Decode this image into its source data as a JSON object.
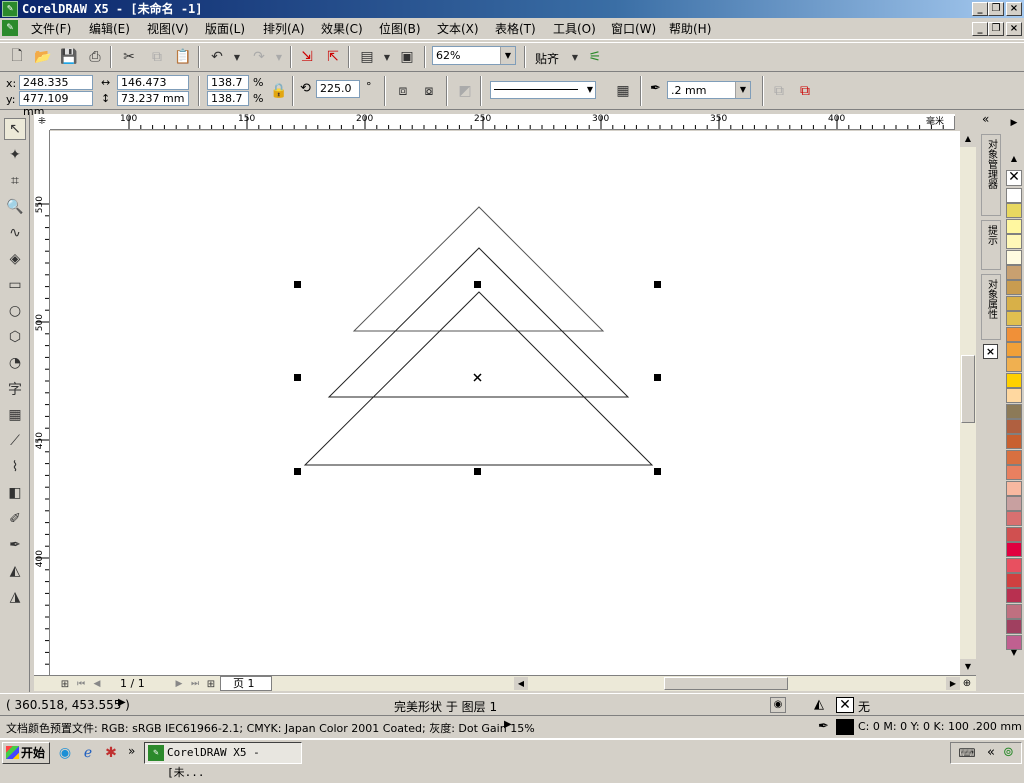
{
  "window": {
    "title": "CorelDRAW X5 - [未命名 -1]",
    "app_icon": "corel-icon"
  },
  "menu": [
    "文件(F)",
    "编辑(E)",
    "视图(V)",
    "版面(L)",
    "排列(A)",
    "效果(C)",
    "位图(B)",
    "文本(X)",
    "表格(T)",
    "工具(O)",
    "窗口(W)",
    "帮助(H)"
  ],
  "toolbar": {
    "zoom": "62%",
    "snap_label": "贴齐"
  },
  "props": {
    "x_label": "x:",
    "y_label": "y:",
    "x": "248.335 mm",
    "y": "477.109 mm",
    "w": "146.473 mm",
    "h": "73.237 mm",
    "sx": "138.7",
    "sy": "138.7",
    "pct": "%",
    "rotation": "225.0",
    "deg": "°",
    "outline_width": ".2 mm"
  },
  "rulers": {
    "top_ticks": [
      "100",
      "150",
      "200",
      "250",
      "300",
      "350",
      "400"
    ],
    "left_ticks": [
      "550",
      "500",
      "450",
      "400"
    ],
    "unit": "毫米"
  },
  "page_nav": {
    "pages": "1 / 1",
    "tab": "页 1"
  },
  "dockers": {
    "tab1": "对象管理器",
    "tab2": "提示",
    "tab3": "对象属性"
  },
  "palette": [
    "#ffffff",
    "#e8d860",
    "#fff7a0",
    "#fff8b8",
    "#fffbe0",
    "#c8a070",
    "#c89c50",
    "#d8b048",
    "#e0c050",
    "#f09038",
    "#f0a038",
    "#f0b050",
    "#ffd000",
    "#ffd8a0",
    "#8c7a58",
    "#b06040",
    "#c86030",
    "#d87040",
    "#e88060",
    "#f8b8a0",
    "#c8a0a0",
    "#d87070",
    "#d05050",
    "#e00040",
    "#e85060",
    "#d04040",
    "#b83050",
    "#c07080",
    "#a04060",
    "#c06090"
  ],
  "status": {
    "coords": "( 360.518, 453.555 )",
    "object_info": "完美形状 于 图层 1",
    "fill_label": "无",
    "color_profile": "文档颜色预置文件: RGB: sRGB IEC61966-2.1; CMYK: Japan Color 2001 Coated; 灰度: Dot Gain 15%",
    "outline_info": "C: 0 M: 0 Y: 0 K: 100  .200 mm"
  },
  "taskbar": {
    "start": "开始",
    "task": "CorelDRAW X5 - [未..."
  }
}
